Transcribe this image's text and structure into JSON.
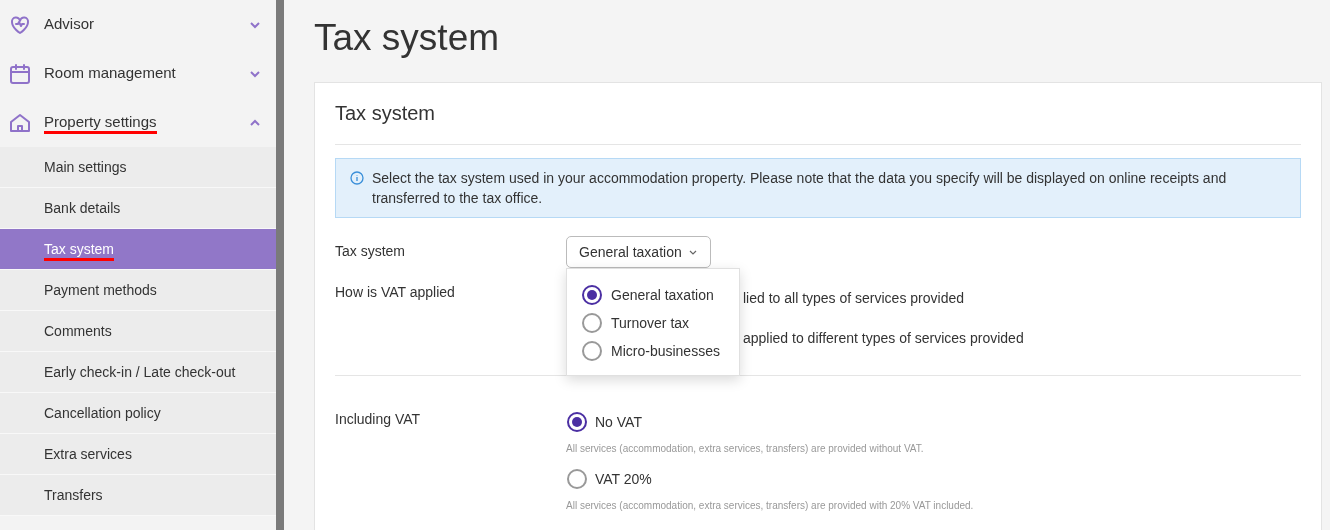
{
  "sidebar": {
    "sections": [
      {
        "label": "Advisor",
        "kind": "heart",
        "expanded": false,
        "underlined": false
      },
      {
        "label": "Room management",
        "kind": "calendar",
        "expanded": false,
        "underlined": false
      },
      {
        "label": "Property settings",
        "kind": "house",
        "expanded": true,
        "underlined": true
      }
    ],
    "items": [
      {
        "label": "Main settings",
        "selected": false,
        "underlined": false
      },
      {
        "label": "Bank details",
        "selected": false,
        "underlined": false
      },
      {
        "label": "Tax system",
        "selected": true,
        "underlined": true
      },
      {
        "label": "Payment methods",
        "selected": false,
        "underlined": false
      },
      {
        "label": "Comments",
        "selected": false,
        "underlined": false
      },
      {
        "label": "Early check-in / Late check-out",
        "selected": false,
        "underlined": false
      },
      {
        "label": "Cancellation policy",
        "selected": false,
        "underlined": false
      },
      {
        "label": "Extra services",
        "selected": false,
        "underlined": false
      },
      {
        "label": "Transfers",
        "selected": false,
        "underlined": false
      }
    ]
  },
  "page_title": "Tax system",
  "card": {
    "title": "Tax system",
    "info": "Select the tax system used in your accommodation property. Please note that the data you specify will be displayed on online receipts and transferred to the tax office.",
    "tax_system": {
      "label": "Tax system",
      "value": "General taxation",
      "options": [
        {
          "label": "General taxation",
          "selected": true
        },
        {
          "label": "Turnover tax",
          "selected": false
        },
        {
          "label": "Micro-businesses",
          "selected": false
        }
      ]
    },
    "vat_applied": {
      "label": "How is VAT applied",
      "fragments": [
        "lied to all types of services provided",
        "applied to different types of services provided"
      ]
    },
    "including_vat": {
      "label": "Including VAT",
      "options": [
        {
          "label": "No VAT",
          "hint": "All services (accommodation, extra services, transfers) are provided without VAT.",
          "selected": true
        },
        {
          "label": "VAT 20%",
          "hint": "All services (accommodation, extra services, transfers) are provided with 20% VAT included.",
          "selected": false
        }
      ]
    }
  }
}
